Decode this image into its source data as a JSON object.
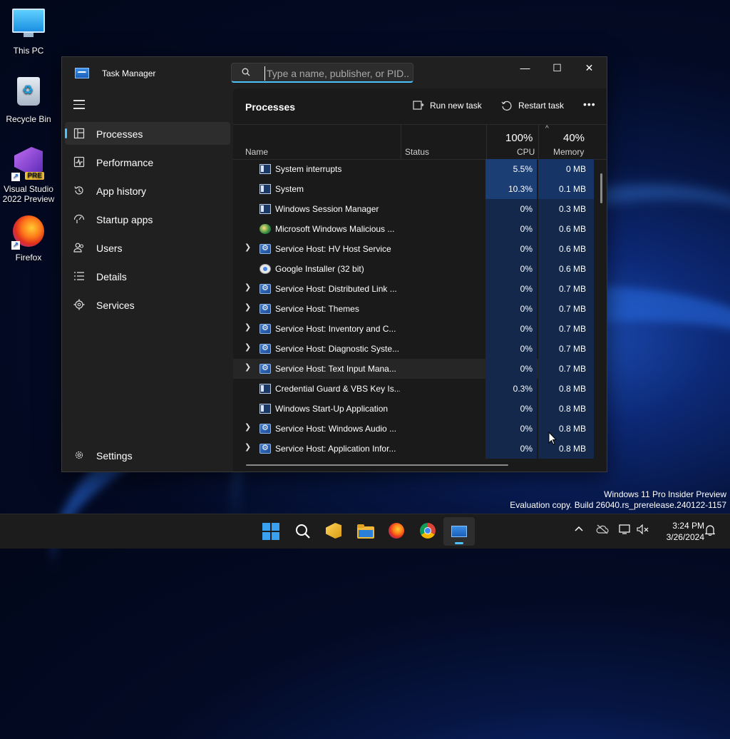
{
  "desktop": {
    "icons": [
      {
        "label": "This PC"
      },
      {
        "label": "Recycle Bin"
      },
      {
        "label": "Visual Studio 2022 Preview",
        "badge": "PRE"
      },
      {
        "label": "Firefox"
      }
    ],
    "watermark": {
      "line1": "Windows 11 Pro Insider Preview",
      "line2": "Evaluation copy. Build 26040.rs_prerelease.240122-1157"
    }
  },
  "window": {
    "title": "Task Manager",
    "search_placeholder": "Type a name, publisher, or PID...",
    "controls": {
      "minimize": "—",
      "maximize": "☐",
      "close": "✕"
    }
  },
  "sidebar": {
    "items": [
      {
        "label": "Processes",
        "icon": "processes-icon"
      },
      {
        "label": "Performance",
        "icon": "performance-icon"
      },
      {
        "label": "App history",
        "icon": "history-icon"
      },
      {
        "label": "Startup apps",
        "icon": "startup-icon"
      },
      {
        "label": "Users",
        "icon": "users-icon"
      },
      {
        "label": "Details",
        "icon": "details-icon"
      },
      {
        "label": "Services",
        "icon": "services-icon"
      }
    ],
    "settings_label": "Settings"
  },
  "toolbar": {
    "page_title": "Processes",
    "run_new_task": "Run new task",
    "restart_task": "Restart task",
    "more": "•••"
  },
  "table": {
    "columns": {
      "name": "Name",
      "status": "Status",
      "cpu_pct": "100%",
      "cpu": "CPU",
      "mem_pct": "40%",
      "mem": "Memory",
      "sort_indicator": "^"
    },
    "rows": [
      {
        "name": "System interrupts",
        "cpu": "5.5%",
        "mem": "0 MB",
        "icon": "system",
        "expandable": false
      },
      {
        "name": "System",
        "cpu": "10.3%",
        "mem": "0.1 MB",
        "icon": "system",
        "expandable": false
      },
      {
        "name": "Windows Session Manager",
        "cpu": "0%",
        "mem": "0.3 MB",
        "icon": "system",
        "expandable": false
      },
      {
        "name": "Microsoft Windows Malicious ...",
        "cpu": "0%",
        "mem": "0.6 MB",
        "icon": "shield",
        "expandable": false
      },
      {
        "name": "Service Host: HV Host Service",
        "cpu": "0%",
        "mem": "0.6 MB",
        "icon": "service",
        "expandable": true
      },
      {
        "name": "Google Installer (32 bit)",
        "cpu": "0%",
        "mem": "0.6 MB",
        "icon": "google",
        "expandable": false
      },
      {
        "name": "Service Host: Distributed Link ...",
        "cpu": "0%",
        "mem": "0.7 MB",
        "icon": "service",
        "expandable": true
      },
      {
        "name": "Service Host: Themes",
        "cpu": "0%",
        "mem": "0.7 MB",
        "icon": "service",
        "expandable": true
      },
      {
        "name": "Service Host: Inventory and C...",
        "cpu": "0%",
        "mem": "0.7 MB",
        "icon": "service",
        "expandable": true
      },
      {
        "name": "Service Host: Diagnostic Syste...",
        "cpu": "0%",
        "mem": "0.7 MB",
        "icon": "service",
        "expandable": true
      },
      {
        "name": "Service Host: Text Input Mana...",
        "cpu": "0%",
        "mem": "0.7 MB",
        "icon": "service",
        "expandable": true
      },
      {
        "name": "Credential Guard & VBS Key Is...",
        "cpu": "0.3%",
        "mem": "0.8 MB",
        "icon": "system",
        "expandable": false
      },
      {
        "name": "Windows Start-Up Application",
        "cpu": "0%",
        "mem": "0.8 MB",
        "icon": "system",
        "expandable": false
      },
      {
        "name": "Service Host: Windows Audio ...",
        "cpu": "0%",
        "mem": "0.8 MB",
        "icon": "service",
        "expandable": true
      },
      {
        "name": "Service Host: Application Infor...",
        "cpu": "0%",
        "mem": "0.8 MB",
        "icon": "service",
        "expandable": true
      }
    ]
  },
  "taskbar": {
    "apps": [
      "start-icon",
      "search-icon",
      "vs-preview-icon",
      "file-explorer-icon",
      "firefox-icon",
      "chrome-icon",
      "task-manager-icon"
    ],
    "clock_time": "3:24 PM",
    "clock_date": "3/26/2024"
  },
  "colors": {
    "accent": "#4cc2ff",
    "cpu_heat_high": "#1b3f75",
    "cpu_heat_low": "#13284a"
  }
}
